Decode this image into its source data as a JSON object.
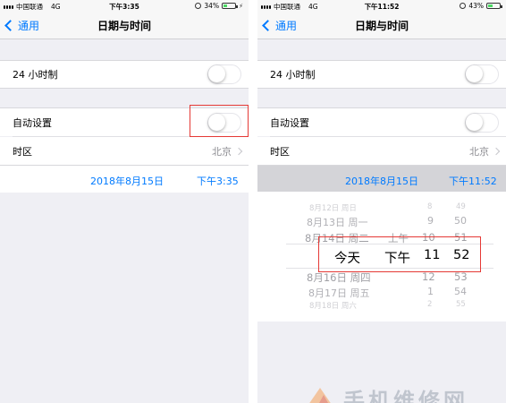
{
  "left_screen": {
    "status": {
      "carrier": "中国联通",
      "network": "4G",
      "time": "下午3:35",
      "battery": "34%",
      "battery_level": 0.34
    },
    "nav": {
      "back_label": "通用",
      "title": "日期与时间"
    },
    "rows": {
      "hour24_label": "24 小时制",
      "auto_label": "自动设置",
      "timezone_label": "时区",
      "timezone_value": "北京"
    },
    "datetime": {
      "date": "2018年8月15日",
      "time": "下午3:35"
    }
  },
  "right_screen": {
    "status": {
      "carrier": "中国联通",
      "network": "4G",
      "time": "下午11:52",
      "battery": "43%",
      "battery_level": 0.43
    },
    "nav": {
      "back_label": "通用",
      "title": "日期与时间"
    },
    "rows": {
      "hour24_label": "24 小时制",
      "auto_label": "自动设置",
      "timezone_label": "时区",
      "timezone_value": "北京"
    },
    "datetime": {
      "date": "2018年8月15日",
      "time": "下午11:52"
    },
    "picker": {
      "rows_top": [
        {
          "date": "8月12日 周日",
          "hour": "8",
          "minute": "49"
        },
        {
          "date": "8月13日 周一",
          "hour": "9",
          "minute": "50"
        },
        {
          "date": "8月14日 周二",
          "ampm": "上午",
          "hour": "10",
          "minute": "51"
        }
      ],
      "selected": {
        "date": "今天",
        "ampm": "下午",
        "hour": "11",
        "minute": "52"
      },
      "rows_bottom": [
        {
          "date": "8月16日 周四",
          "hour": "12",
          "minute": "53"
        },
        {
          "date": "8月17日 周五",
          "hour": "1",
          "minute": "54"
        },
        {
          "date": "8月18日 周六",
          "hour": "2",
          "minute": "55"
        }
      ]
    }
  },
  "watermark": {
    "text": "手机维修网"
  },
  "colors": {
    "accent": "#007aff",
    "highlight": "#e53935",
    "toggle_off_border": "#e5e5ea"
  }
}
